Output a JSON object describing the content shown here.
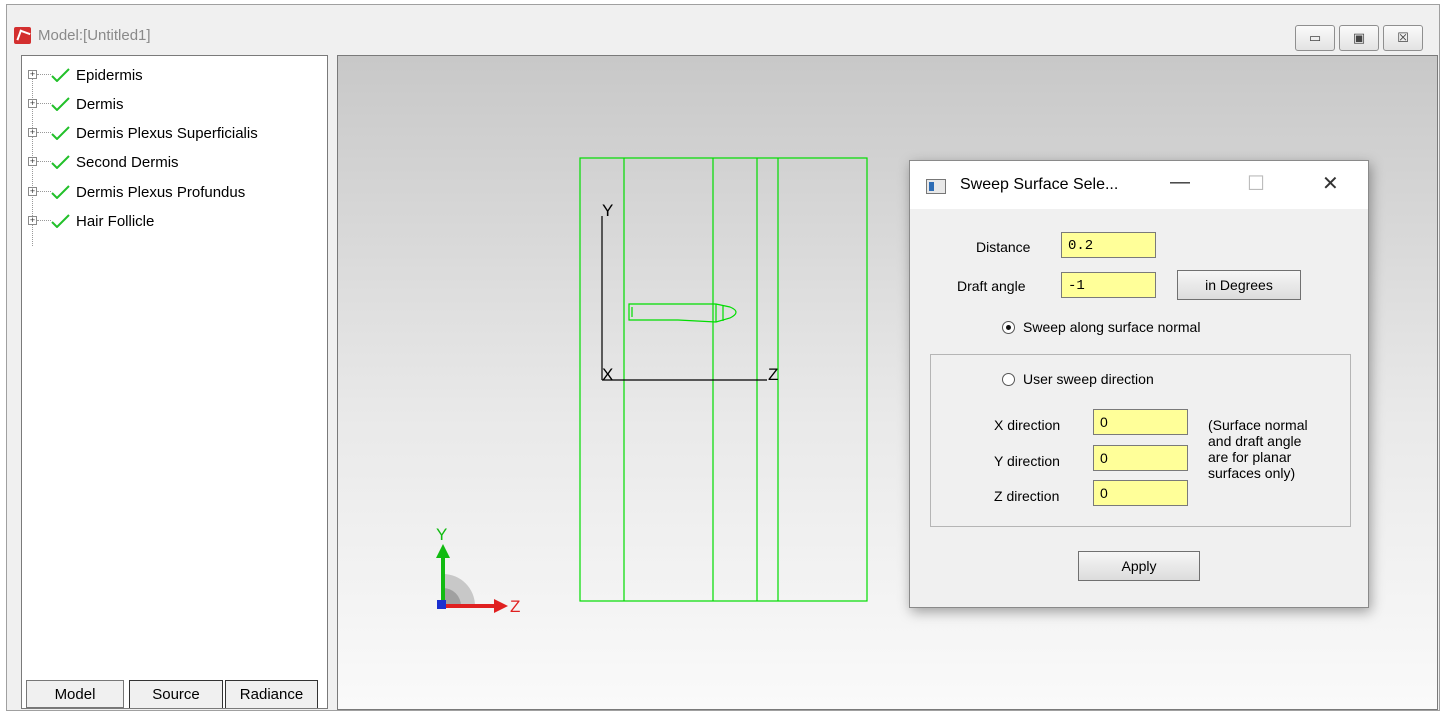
{
  "window": {
    "title": "Model:[Untitled1]",
    "controls": {
      "minimize": "▭",
      "restore": "▣",
      "close": "☒"
    }
  },
  "tree": {
    "items": [
      {
        "label": "Epidermis",
        "checked": true
      },
      {
        "label": "Dermis",
        "checked": true
      },
      {
        "label": "Dermis Plexus Superficialis",
        "checked": true
      },
      {
        "label": "Second Dermis",
        "checked": true
      },
      {
        "label": "Dermis Plexus Profundus",
        "checked": true
      },
      {
        "label": "Hair Follicle",
        "checked": true
      }
    ]
  },
  "tabs": [
    {
      "label": "Model",
      "active": true
    },
    {
      "label": "Source",
      "active": false
    },
    {
      "label": "Radiance",
      "active": false
    }
  ],
  "viewport": {
    "model_axes": {
      "y": "Y",
      "x": "X",
      "z": "Z"
    },
    "triad": {
      "y": "Y",
      "z": "Z"
    },
    "wire_color": "#00dd00"
  },
  "dialog": {
    "title": "Sweep Surface Sele...",
    "controls": {
      "minimize": "—",
      "maximize": "☐",
      "close": "✕"
    },
    "distance_label": "Distance",
    "distance_value": "0.2",
    "draft_angle_label": "Draft angle",
    "draft_angle_value": "-1",
    "units_button": "in Degrees",
    "radio_normal": {
      "label": "Sweep along surface normal",
      "checked": true
    },
    "radio_user": {
      "label": "User sweep direction",
      "checked": false
    },
    "x_label": "X direction",
    "x_value": "0",
    "y_label": "Y direction",
    "y_value": "0",
    "z_label": "Z direction",
    "z_value": "0",
    "note_lines": [
      "(Surface normal",
      "and draft angle",
      "are for planar",
      "surfaces only)"
    ],
    "apply_button": "Apply",
    "field_color": "#ffff99"
  }
}
